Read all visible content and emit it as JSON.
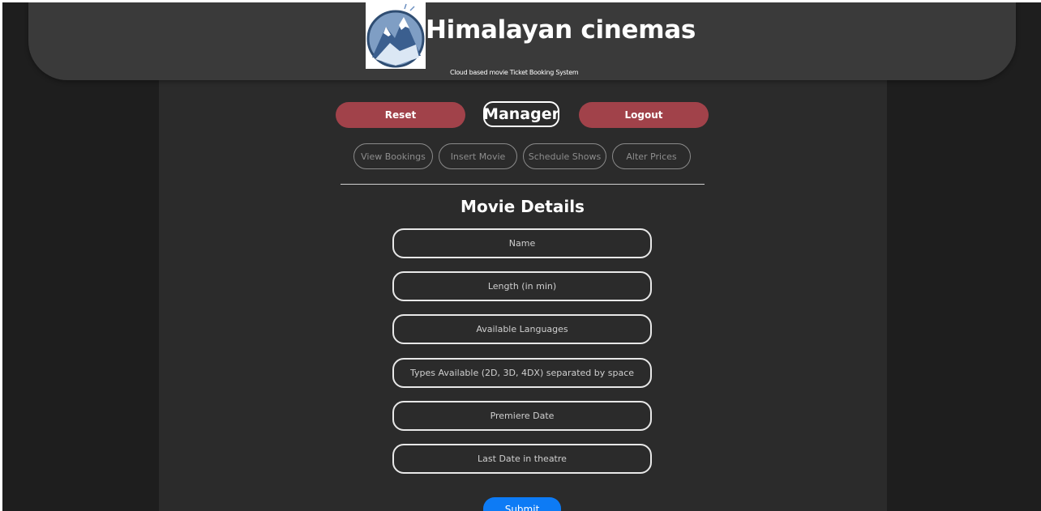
{
  "site": {
    "title": "Himalayan cinemas",
    "subtitle": "Cloud based movie Ticket Booking System",
    "logo_icon": "mountain-logo-icon"
  },
  "actions": {
    "reset_label": "Reset",
    "role_label": "Manager",
    "logout_label": "Logout"
  },
  "nav": {
    "items": [
      {
        "label": "View Bookings"
      },
      {
        "label": "Insert Movie"
      },
      {
        "label": "Schedule Shows"
      },
      {
        "label": "Alter Prices"
      }
    ]
  },
  "form": {
    "title": "Movie Details",
    "fields": [
      {
        "placeholder": "Name",
        "value": ""
      },
      {
        "placeholder": "Length (in min)",
        "value": ""
      },
      {
        "placeholder": "Available Languages",
        "value": ""
      },
      {
        "placeholder": "Types Available (2D, 3D, 4DX) separated by space",
        "value": ""
      },
      {
        "placeholder": "Premiere Date",
        "value": ""
      },
      {
        "placeholder": "Last Date in theatre",
        "value": ""
      }
    ],
    "submit_label": "Submit"
  },
  "colors": {
    "background": "#1e1e1e",
    "panel": "#2b2b2b",
    "header": "#3a3a3a",
    "accent_red": "#a1424a",
    "submit_blue": "#0d7bf5"
  }
}
